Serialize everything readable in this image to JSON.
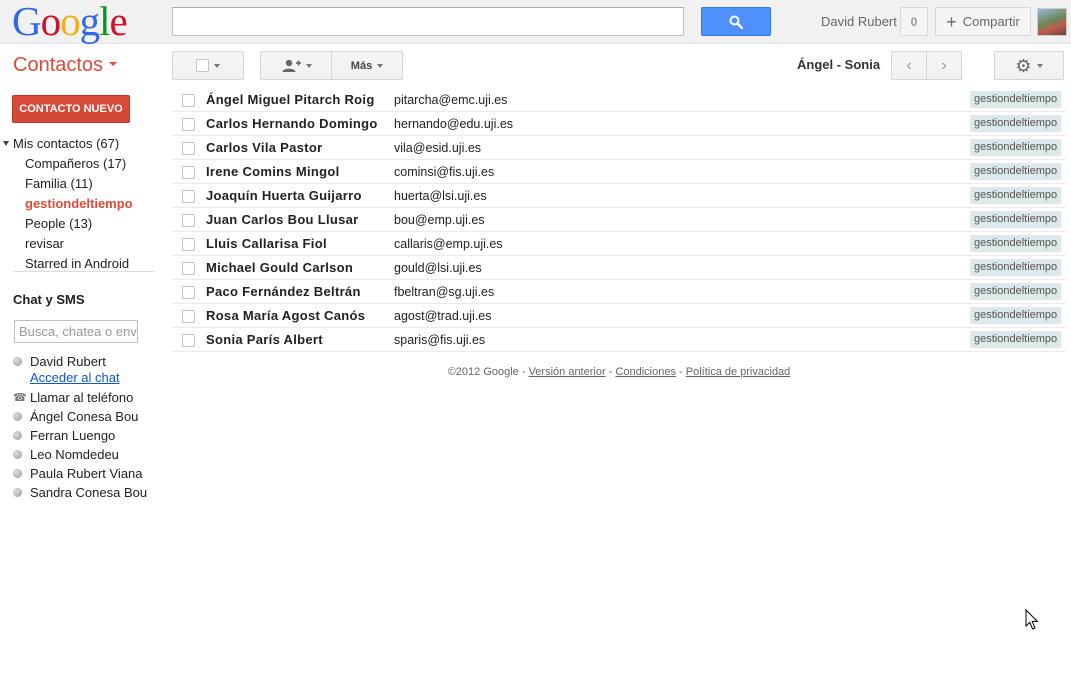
{
  "header": {
    "logo_letters": [
      {
        "ch": "G",
        "color": "#3369e8"
      },
      {
        "ch": "o",
        "color": "#d50f25"
      },
      {
        "ch": "o",
        "color": "#eeb211"
      },
      {
        "ch": "g",
        "color": "#3369e8"
      },
      {
        "ch": "l",
        "color": "#009925"
      },
      {
        "ch": "e",
        "color": "#d50f25"
      }
    ],
    "search_value": "",
    "search_icon": "magnifier-icon",
    "user_name": "David Rubert",
    "notification_count": "0",
    "share_label": "Compartir"
  },
  "toolbar": {
    "app_title": "Contactos",
    "more_label": "Más",
    "range_label": "Ángel - Sonia"
  },
  "sidebar": {
    "new_contact_label": "CONTACTO NUEVO",
    "groups": [
      {
        "label": "Mis contactos (67)",
        "top": true,
        "active": false
      },
      {
        "label": "Compañeros (17)",
        "top": false,
        "active": false
      },
      {
        "label": "Familia (11)",
        "top": false,
        "active": false
      },
      {
        "label": "gestiondeltiempo",
        "top": false,
        "active": true
      },
      {
        "label": "People (13)",
        "top": false,
        "active": false
      },
      {
        "label": "revisar",
        "top": false,
        "active": false
      },
      {
        "label": "Starred in Android",
        "top": false,
        "active": false
      }
    ],
    "chat_heading": "Chat y SMS",
    "chat_search_placeholder": "Busca, chatea o envía SMS",
    "self_name": "David Rubert",
    "chat_link": "Acceder al chat",
    "call_phone": "Llamar al teléfono",
    "chat_contacts": [
      "Ángel Conesa Bou",
      "Ferran Luengo",
      "Leo Nomdedeu",
      "Paula Rubert Viana",
      "Sandra Conesa Bou"
    ]
  },
  "contacts": [
    {
      "name": "Ángel Miguel Pitarch Roig",
      "email": "pitarcha@emc.uji.es",
      "label": "gestiondeltiempo"
    },
    {
      "name": "Carlos Hernando Domingo",
      "email": "hernando@edu.uji.es",
      "label": "gestiondeltiempo"
    },
    {
      "name": "Carlos Vila Pastor",
      "email": "vila@esid.uji.es",
      "label": "gestiondeltiempo"
    },
    {
      "name": "Irene Comins Mingol",
      "email": "cominsi@fis.uji.es",
      "label": "gestiondeltiempo"
    },
    {
      "name": "Joaquín Huerta Guijarro",
      "email": "huerta@lsi.uji.es",
      "label": "gestiondeltiempo"
    },
    {
      "name": "Juan Carlos Bou Llusar",
      "email": "bou@emp.uji.es",
      "label": "gestiondeltiempo"
    },
    {
      "name": "Lluis Callarisa Fiol",
      "email": "callaris@emp.uji.es",
      "label": "gestiondeltiempo"
    },
    {
      "name": "Michael Gould Carlson",
      "email": "gould@lsi.uji.es",
      "label": "gestiondeltiempo"
    },
    {
      "name": "Paco Fernández Beltrán",
      "email": "fbeltran@sg.uji.es",
      "label": "gestiondeltiempo"
    },
    {
      "name": "Rosa María Agost Canós",
      "email": "agost@trad.uji.es",
      "label": "gestiondeltiempo"
    },
    {
      "name": "Sonia París Albert",
      "email": "sparis@fis.uji.es",
      "label": "gestiondeltiempo"
    }
  ],
  "footer": {
    "copyright": "©2012 Google",
    "sep": " - ",
    "link_previous": "Versión anterior",
    "link_terms": "Condiciones",
    "link_privacy": "Política de privacidad"
  },
  "colors": {
    "accent_red": "#dd4b39",
    "search_blue": "#4d90fe",
    "link_blue": "#15c",
    "label_bg": "#dde8ea"
  }
}
